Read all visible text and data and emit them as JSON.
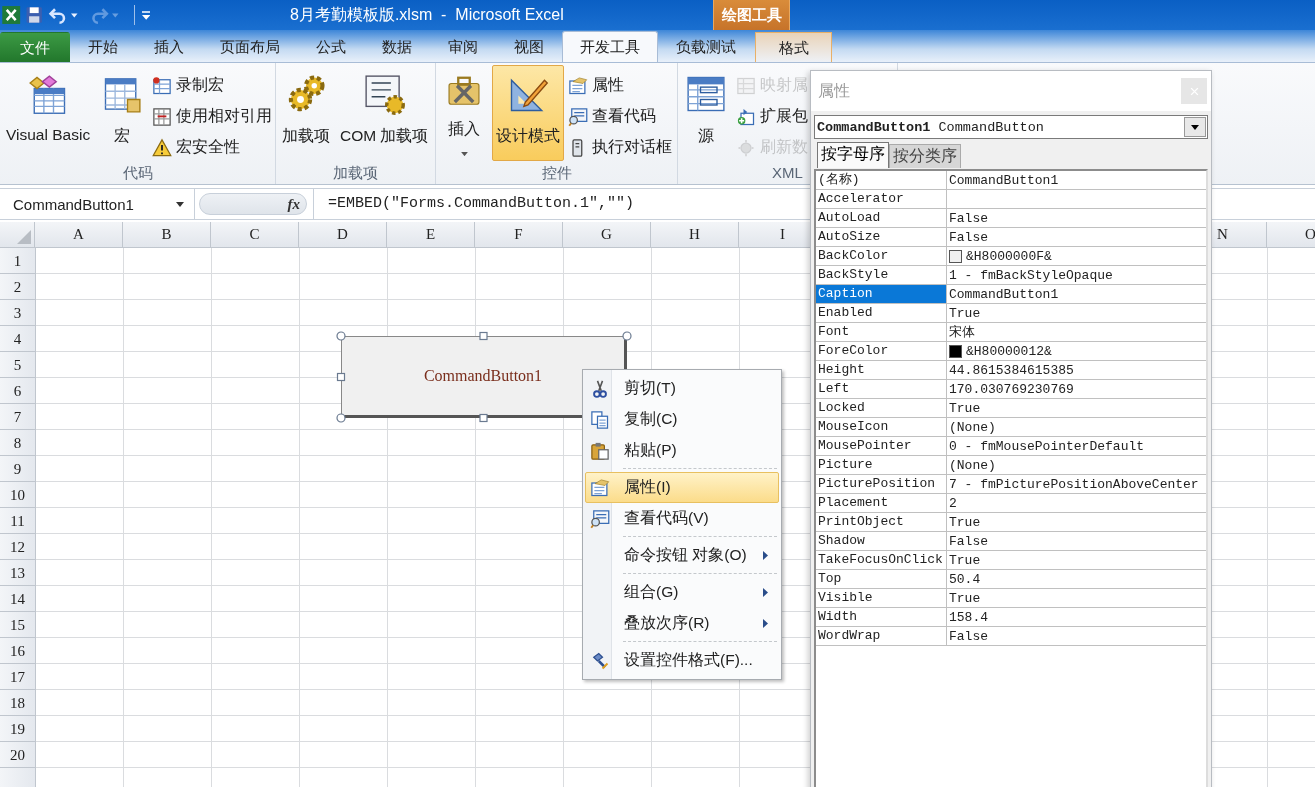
{
  "window": {
    "title": "8月考勤模板版.xlsm  -  Microsoft Excel"
  },
  "quick_access": [
    {
      "kind": "save",
      "disabled": false,
      "dropdown": false
    },
    {
      "kind": "undo",
      "disabled": false,
      "dropdown": true
    },
    {
      "kind": "redo",
      "disabled": true,
      "dropdown": true
    }
  ],
  "contextual_group": {
    "title": "绘图工具"
  },
  "tabs": [
    {
      "label": "文件",
      "kind": "file",
      "selected": false
    },
    {
      "label": "开始",
      "kind": "normal",
      "selected": false
    },
    {
      "label": "插入",
      "kind": "normal",
      "selected": false
    },
    {
      "label": "页面布局",
      "kind": "normal",
      "selected": false
    },
    {
      "label": "公式",
      "kind": "normal",
      "selected": false
    },
    {
      "label": "数据",
      "kind": "normal",
      "selected": false
    },
    {
      "label": "审阅",
      "kind": "normal",
      "selected": false
    },
    {
      "label": "视图",
      "kind": "normal",
      "selected": false
    },
    {
      "label": "开发工具",
      "kind": "normal",
      "selected": true
    },
    {
      "label": "负载测试",
      "kind": "normal",
      "selected": false
    },
    {
      "label": "格式",
      "kind": "contextual",
      "selected": false
    }
  ],
  "ribbon": {
    "groups": [
      {
        "label": "代码",
        "large": [
          {
            "label": "Visual Basic",
            "on": false,
            "dropdown": false
          },
          {
            "label": "宏",
            "on": false,
            "dropdown": false
          }
        ],
        "small": [
          {
            "label": "录制宏",
            "disabled": false
          },
          {
            "label": "使用相对引用",
            "disabled": false
          },
          {
            "label": "宏安全性",
            "disabled": false
          }
        ]
      },
      {
        "label": "加载项",
        "large": [
          {
            "label": "加载项",
            "on": false,
            "dropdown": false
          },
          {
            "label": "COM 加载项",
            "on": false,
            "dropdown": false
          }
        ]
      },
      {
        "label": "控件",
        "large": [
          {
            "label": "插入",
            "on": false,
            "dropdown": true
          },
          {
            "label": "设计模式",
            "on": true,
            "dropdown": false
          }
        ],
        "small": [
          {
            "label": "属性",
            "disabled": false
          },
          {
            "label": "查看代码",
            "disabled": false
          },
          {
            "label": "执行对话框",
            "disabled": false
          }
        ]
      },
      {
        "label": "XML",
        "large": [
          {
            "label": "源",
            "on": false,
            "dropdown": false
          }
        ],
        "small": [
          {
            "label": "映射属",
            "disabled": true
          },
          {
            "label": "扩展包",
            "disabled": false
          },
          {
            "label": "刷新数",
            "disabled": true
          }
        ]
      }
    ]
  },
  "formula_bar": {
    "name_box": "CommandButton1",
    "function_label": "fx",
    "formula": "=EMBED(\"Forms.CommandButton.1\",\"\")"
  },
  "sheet": {
    "columns_left": [
      "A",
      "B",
      "C",
      "D",
      "E",
      "F",
      "G",
      "H",
      "I"
    ],
    "columns_right": [
      "N",
      "O"
    ],
    "rows": [
      "1",
      "2",
      "3",
      "4",
      "5",
      "6",
      "7",
      "8",
      "9",
      "10",
      "11",
      "12",
      "13",
      "14",
      "15",
      "16",
      "17",
      "18",
      "19",
      "20"
    ]
  },
  "embedded_button": {
    "caption": "CommandButton1",
    "selected": true
  },
  "context_menu": {
    "groups": [
      {
        "items": [
          {
            "label": "剪切(T)",
            "selected": false,
            "submenu": false
          },
          {
            "label": "复制(C)",
            "selected": false,
            "submenu": false
          },
          {
            "label": "粘贴(P)",
            "selected": false,
            "submenu": false
          }
        ]
      },
      {
        "items": [
          {
            "label": "属性(I)",
            "selected": true,
            "submenu": false
          },
          {
            "label": "查看代码(V)",
            "selected": false,
            "submenu": false
          }
        ]
      },
      {
        "items": [
          {
            "label": "命令按钮 对象(O)",
            "selected": false,
            "submenu": true
          }
        ]
      },
      {
        "items": [
          {
            "label": "组合(G)",
            "selected": false,
            "submenu": true
          },
          {
            "label": "叠放次序(R)",
            "selected": false,
            "submenu": true
          }
        ]
      },
      {
        "items": [
          {
            "label": "设置控件格式(F)...",
            "selected": false,
            "submenu": false
          }
        ]
      }
    ]
  },
  "properties_window": {
    "title": "属性",
    "active": false,
    "object_name": "CommandButton1",
    "object_type": "CommandButton",
    "tabs": [
      {
        "label": "按字母序",
        "selected": true
      },
      {
        "label": "按分类序",
        "selected": false
      }
    ],
    "rows": [
      {
        "name": "(名称)",
        "value": "CommandButton1",
        "selected": false
      },
      {
        "name": "Accelerator",
        "selected": false
      },
      {
        "name": "AutoLoad",
        "value": "False",
        "selected": false
      },
      {
        "name": "AutoSize",
        "value": "False",
        "selected": false
      },
      {
        "name": "BackColor",
        "value": "&H8000000F&",
        "color": "#f0f0f0",
        "selected": false
      },
      {
        "name": "BackStyle",
        "value": "1 - fmBackStyleOpaque",
        "selected": false
      },
      {
        "name": "Caption",
        "value": "CommandButton1",
        "selected": true
      },
      {
        "name": "Enabled",
        "value": "True",
        "selected": false
      },
      {
        "name": "Font",
        "value": "宋体",
        "selected": false
      },
      {
        "name": "ForeColor",
        "value": "&H80000012&",
        "color": "#000000",
        "selected": false
      },
      {
        "name": "Height",
        "value": "44.8615384615385",
        "selected": false
      },
      {
        "name": "Left",
        "value": "170.030769230769",
        "selected": false
      },
      {
        "name": "Locked",
        "value": "True",
        "selected": false
      },
      {
        "name": "MouseIcon",
        "value": "(None)",
        "selected": false
      },
      {
        "name": "MousePointer",
        "value": "0 - fmMousePointerDefault",
        "selected": false
      },
      {
        "name": "Picture",
        "value": "(None)",
        "selected": false
      },
      {
        "name": "PicturePosition",
        "value": "7 - fmPicturePositionAboveCenter",
        "selected": false
      },
      {
        "name": "Placement",
        "value": "2",
        "selected": false
      },
      {
        "name": "PrintObject",
        "value": "True",
        "selected": false
      },
      {
        "name": "Shadow",
        "value": "False",
        "selected": false
      },
      {
        "name": "TakeFocusOnClick",
        "value": "True",
        "selected": false
      },
      {
        "name": "Top",
        "value": "50.4",
        "selected": false
      },
      {
        "name": "Visible",
        "value": "True",
        "selected": false
      },
      {
        "name": "Width",
        "value": "158.4",
        "selected": false
      },
      {
        "name": "WordWrap",
        "value": "False",
        "selected": false
      }
    ]
  }
}
